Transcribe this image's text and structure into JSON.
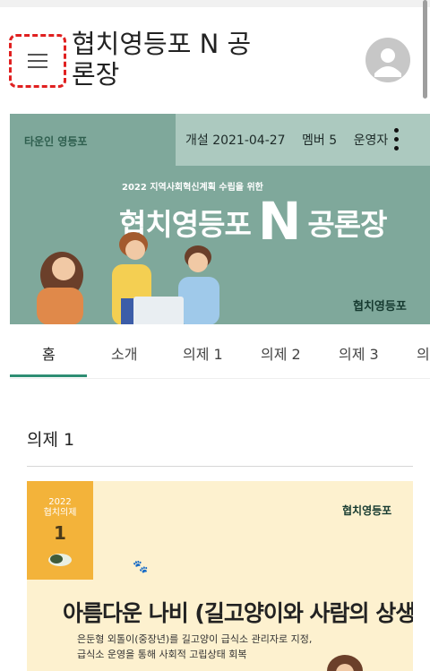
{
  "header": {
    "title": "협치영등포 N 공론장"
  },
  "banner": {
    "info": {
      "opened": "개설 2021-04-27",
      "members": "멤버 5",
      "admin": "운영자"
    },
    "logo": "타운인 영등포",
    "subline": "2022 지역사회혁신계획 수립을 위한",
    "headline_left": "협치영등포",
    "headline_big": "N",
    "headline_right": "공론장",
    "stamp": "협치영등포"
  },
  "tabs": [
    "홈",
    "소개",
    "의제 1",
    "의제 2",
    "의제 3",
    "의"
  ],
  "active_tab": 0,
  "section": {
    "title": "의제 1"
  },
  "card": {
    "badge_line1": "2022",
    "badge_line2": "협치의제",
    "badge_num": "1",
    "stamp": "협치영등포",
    "paw": "🐾",
    "title": "아름다운 나비 (길고양이와 사람의 상생)",
    "desc_line1": "은둔형 외톨이(중장년)를 길고양이 급식소 관리자로 지정,",
    "desc_line2": "급식소 운영을 통해 사회적 고립상태 회복"
  },
  "colors": {
    "accent": "#2e8e73",
    "banner_bg": "#7fa89b",
    "badge_bg": "#f3b33a",
    "card_bg": "#fdf1cf",
    "highlight": "#e02020"
  },
  "icons": {
    "menu": "hamburger-menu-icon",
    "avatar": "user-avatar-icon",
    "more": "kebab-more-icon"
  }
}
